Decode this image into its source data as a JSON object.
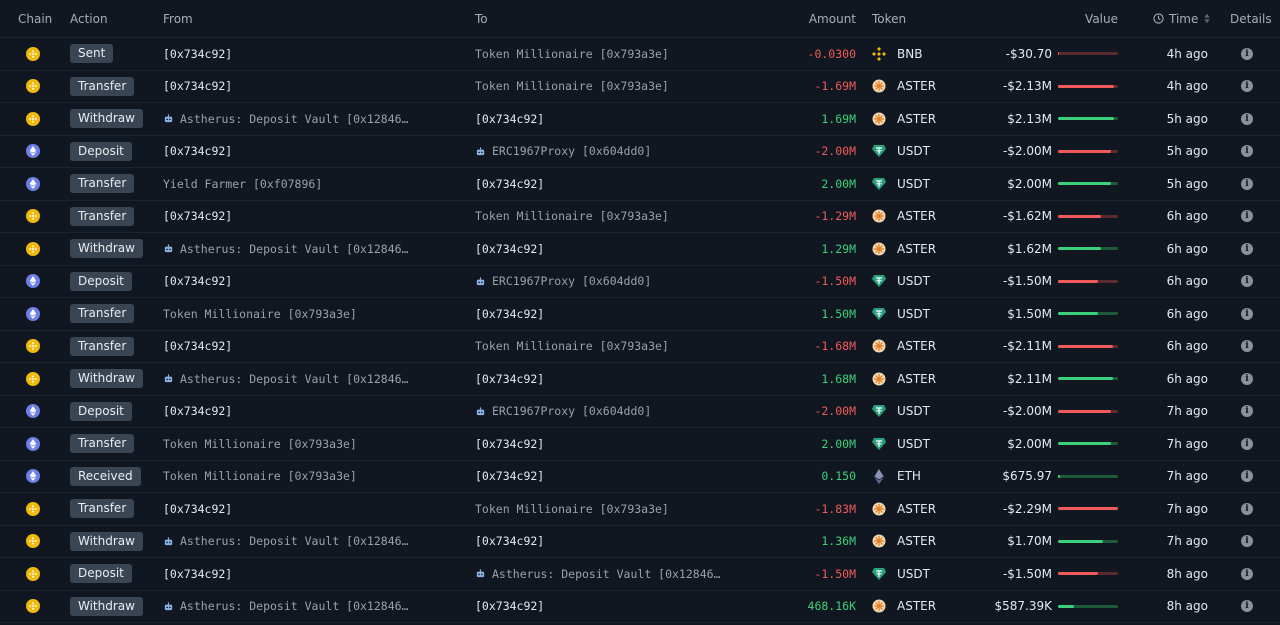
{
  "header": {
    "chain": "Chain",
    "action": "Action",
    "from": "From",
    "to": "To",
    "amount": "Amount",
    "token": "Token",
    "value": "Value",
    "time": "Time",
    "details": "Details"
  },
  "colors": {
    "negative": "#f05a5a",
    "positive": "#3dd17b",
    "bnb": "#f0b90b",
    "eth": "#6c7fe8",
    "usdt": "#26a17b"
  },
  "rows": [
    {
      "chain": "bnb",
      "action": "Sent",
      "from": "[0x734c92]",
      "from_type": "own",
      "to": "Token Millionaire [0x793a3e]",
      "to_type": "label",
      "amount": "-0.0300",
      "sign": "neg",
      "token": "BNB",
      "value": "-$30.70",
      "bar": 0.02,
      "time": "4h ago"
    },
    {
      "chain": "bnb",
      "action": "Transfer",
      "from": "[0x734c92]",
      "from_type": "own",
      "to": "Token Millionaire [0x793a3e]",
      "to_type": "label",
      "amount": "-1.69M",
      "sign": "neg",
      "token": "ASTER",
      "value": "-$2.13M",
      "bar": 0.93,
      "time": "4h ago"
    },
    {
      "chain": "bnb",
      "action": "Withdraw",
      "from": "Astherus: Deposit Vault [0x12846…",
      "from_type": "bot",
      "to": "[0x734c92]",
      "to_type": "own",
      "amount": "1.69M",
      "sign": "pos",
      "token": "ASTER",
      "value": "$2.13M",
      "bar": 0.93,
      "time": "5h ago"
    },
    {
      "chain": "eth",
      "action": "Deposit",
      "from": "[0x734c92]",
      "from_type": "own",
      "to": "ERC1967Proxy [0x604dd0]",
      "to_type": "bot",
      "amount": "-2.00M",
      "sign": "neg",
      "token": "USDT",
      "value": "-$2.00M",
      "bar": 0.88,
      "time": "5h ago"
    },
    {
      "chain": "eth",
      "action": "Transfer",
      "from": "Yield Farmer [0xf07896]",
      "from_type": "label",
      "to": "[0x734c92]",
      "to_type": "own",
      "amount": "2.00M",
      "sign": "pos",
      "token": "USDT",
      "value": "$2.00M",
      "bar": 0.88,
      "time": "5h ago"
    },
    {
      "chain": "bnb",
      "action": "Transfer",
      "from": "[0x734c92]",
      "from_type": "own",
      "to": "Token Millionaire [0x793a3e]",
      "to_type": "label",
      "amount": "-1.29M",
      "sign": "neg",
      "token": "ASTER",
      "value": "-$1.62M",
      "bar": 0.71,
      "time": "6h ago"
    },
    {
      "chain": "bnb",
      "action": "Withdraw",
      "from": "Astherus: Deposit Vault [0x12846…",
      "from_type": "bot",
      "to": "[0x734c92]",
      "to_type": "own",
      "amount": "1.29M",
      "sign": "pos",
      "token": "ASTER",
      "value": "$1.62M",
      "bar": 0.71,
      "time": "6h ago"
    },
    {
      "chain": "eth",
      "action": "Deposit",
      "from": "[0x734c92]",
      "from_type": "own",
      "to": "ERC1967Proxy [0x604dd0]",
      "to_type": "bot",
      "amount": "-1.50M",
      "sign": "neg",
      "token": "USDT",
      "value": "-$1.50M",
      "bar": 0.66,
      "time": "6h ago"
    },
    {
      "chain": "eth",
      "action": "Transfer",
      "from": "Token Millionaire [0x793a3e]",
      "from_type": "label",
      "to": "[0x734c92]",
      "to_type": "own",
      "amount": "1.50M",
      "sign": "pos",
      "token": "USDT",
      "value": "$1.50M",
      "bar": 0.66,
      "time": "6h ago"
    },
    {
      "chain": "bnb",
      "action": "Transfer",
      "from": "[0x734c92]",
      "from_type": "own",
      "to": "Token Millionaire [0x793a3e]",
      "to_type": "label",
      "amount": "-1.68M",
      "sign": "neg",
      "token": "ASTER",
      "value": "-$2.11M",
      "bar": 0.92,
      "time": "6h ago"
    },
    {
      "chain": "bnb",
      "action": "Withdraw",
      "from": "Astherus: Deposit Vault [0x12846…",
      "from_type": "bot",
      "to": "[0x734c92]",
      "to_type": "own",
      "amount": "1.68M",
      "sign": "pos",
      "token": "ASTER",
      "value": "$2.11M",
      "bar": 0.92,
      "time": "6h ago"
    },
    {
      "chain": "eth",
      "action": "Deposit",
      "from": "[0x734c92]",
      "from_type": "own",
      "to": "ERC1967Proxy [0x604dd0]",
      "to_type": "bot",
      "amount": "-2.00M",
      "sign": "neg",
      "token": "USDT",
      "value": "-$2.00M",
      "bar": 0.88,
      "time": "7h ago"
    },
    {
      "chain": "eth",
      "action": "Transfer",
      "from": "Token Millionaire [0x793a3e]",
      "from_type": "label",
      "to": "[0x734c92]",
      "to_type": "own",
      "amount": "2.00M",
      "sign": "pos",
      "token": "USDT",
      "value": "$2.00M",
      "bar": 0.88,
      "time": "7h ago"
    },
    {
      "chain": "eth",
      "action": "Received",
      "from": "Token Millionaire [0x793a3e]",
      "from_type": "label",
      "to": "[0x734c92]",
      "to_type": "own",
      "amount": "0.150",
      "sign": "pos",
      "token": "ETH",
      "value": "$675.97",
      "bar": 0.03,
      "time": "7h ago"
    },
    {
      "chain": "bnb",
      "action": "Transfer",
      "from": "[0x734c92]",
      "from_type": "own",
      "to": "Token Millionaire [0x793a3e]",
      "to_type": "label",
      "amount": "-1.83M",
      "sign": "neg",
      "token": "ASTER",
      "value": "-$2.29M",
      "bar": 1.0,
      "time": "7h ago"
    },
    {
      "chain": "bnb",
      "action": "Withdraw",
      "from": "Astherus: Deposit Vault [0x12846…",
      "from_type": "bot",
      "to": "[0x734c92]",
      "to_type": "own",
      "amount": "1.36M",
      "sign": "pos",
      "token": "ASTER",
      "value": "$1.70M",
      "bar": 0.75,
      "time": "7h ago"
    },
    {
      "chain": "bnb",
      "action": "Deposit",
      "from": "[0x734c92]",
      "from_type": "own",
      "to": "Astherus: Deposit Vault [0x12846…",
      "to_type": "bot",
      "amount": "-1.50M",
      "sign": "neg",
      "token": "USDT",
      "value": "-$1.50M",
      "bar": 0.66,
      "time": "8h ago"
    },
    {
      "chain": "bnb",
      "action": "Withdraw",
      "from": "Astherus: Deposit Vault [0x12846…",
      "from_type": "bot",
      "to": "[0x734c92]",
      "to_type": "own",
      "amount": "468.16K",
      "sign": "pos",
      "token": "ASTER",
      "value": "$587.39K",
      "bar": 0.26,
      "time": "8h ago"
    }
  ]
}
